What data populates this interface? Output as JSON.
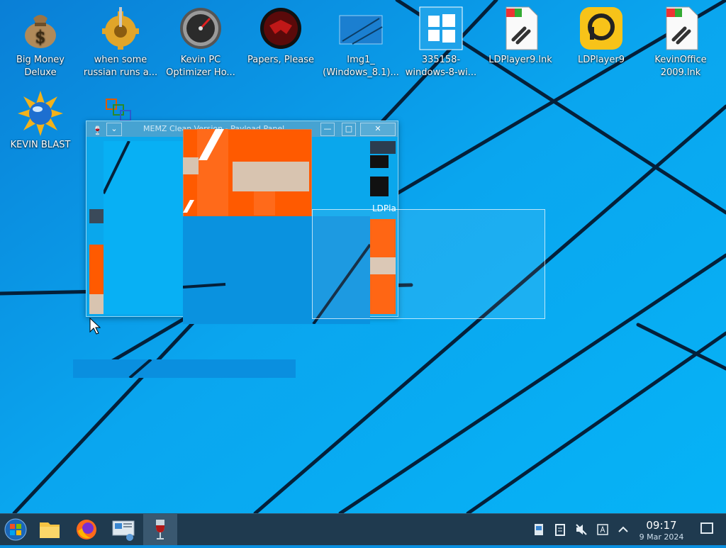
{
  "desktop": {
    "icons": [
      {
        "label_line1": "Big Money",
        "label_line2": "Deluxe",
        "icon": "money-bag-icon"
      },
      {
        "label_line1": "when some",
        "label_line2": "russian runs a...",
        "icon": "gear-icon"
      },
      {
        "label_line1": "Kevin PC",
        "label_line2": "Optimizer Ho...",
        "icon": "speedometer-icon"
      },
      {
        "label_line1": "Papers, Please",
        "label_line2": "",
        "icon": "emblem-icon"
      },
      {
        "label_line1": "Img1_",
        "label_line2": "(Windows_8.1)...",
        "icon": "image-file-icon"
      },
      {
        "label_line1": "335158-",
        "label_line2": "windows-8-wi...",
        "icon": "windows-logo-icon"
      },
      {
        "label_line1": "LDPlayer9.lnk",
        "label_line2": "",
        "icon": "shortcut-file-icon"
      },
      {
        "label_line1": "LDPlayer9",
        "label_line2": "",
        "icon": "ldplayer-icon"
      },
      {
        "label_line1": "KevinOffice",
        "label_line2": "2009.lnk",
        "icon": "shortcut-file-icon"
      },
      {
        "label_line1": "KEVIN BLAST",
        "label_line2": "",
        "icon": "sun-globe-icon"
      }
    ]
  },
  "window": {
    "title": "MEMZ Clean Version - Payload Panel",
    "close_glyph": "✕",
    "minimize_glyph": "—",
    "maximize_glyph": "□",
    "fragment_label": "LDPla"
  },
  "taskbar": {
    "clock_time": "09:17",
    "clock_date": "9 Mar 2024",
    "items": [
      "start-orb-icon",
      "file-explorer-icon",
      "firefox-icon",
      "remote-desktop-icon",
      "wine-glass-icon"
    ]
  },
  "colors": {
    "wallpaper": "#0a8fe0",
    "taskbar": "#1f3a4f",
    "glitch_orange": "#ff5a00"
  }
}
